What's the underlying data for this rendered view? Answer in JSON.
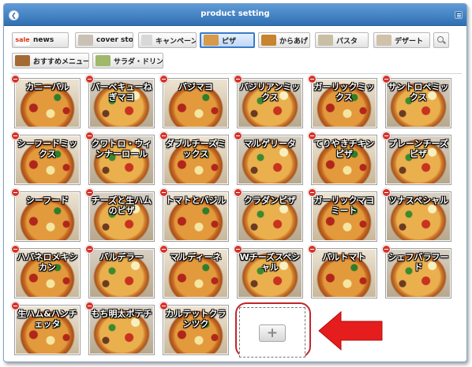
{
  "window": {
    "title": "product setting"
  },
  "tabs": [
    {
      "label": "news",
      "thumb_color": "#ffffff",
      "badge": "sale"
    },
    {
      "label": "cover story",
      "thumb_color": "#c9c1b4"
    },
    {
      "label": "キャンペーン",
      "thumb_color": "#d8d8d8"
    },
    {
      "label": "ピザ",
      "thumb_color": "#d69a4a",
      "active": true
    },
    {
      "label": "からあげ",
      "thumb_color": "#c7832f"
    },
    {
      "label": "パスタ",
      "thumb_color": "#c9bfa4"
    },
    {
      "label": "デザート",
      "thumb_color": "#cfc2a8"
    },
    {
      "label": "",
      "icon": "search-icon"
    },
    {
      "label": "おすすめメニュー",
      "thumb_color": "#a46a32"
    },
    {
      "label": "サラダ・ドリンク",
      "thumb_color": "#9fb86a"
    }
  ],
  "products": [
    "カニーバル",
    "バーベキューねぎマヨ",
    "バジマヨ",
    "バジリアンミックス",
    "ガーリックミックス",
    "サントロペミックス",
    "シーフードミックス",
    "クワトロ・ウィンナーロール",
    "ダブルチーズミックス",
    "マルゲリータ",
    "てりやきチキンピザ",
    "プレーンチーズピザ",
    "シーフード",
    "チーズと生ハムのピザ",
    "トマトとバジル",
    "クラダンピザ",
    "ガーリックマヨミート",
    "ツナスペシャル",
    "ハバネロメキシカン",
    "バルデラー",
    "マルディーネ",
    "Wチーズスペシャル",
    "パルトマト",
    "シェフバラフード",
    "生ハム&ハンチェッタ",
    "もち明太ポテチ",
    "カルテットクランツク"
  ],
  "add_button": {
    "label": "+"
  },
  "colors": {
    "titlebar": "#3a7bc8",
    "delete": "#d6332a",
    "highlight": "#c0262a",
    "arrow": "#e51d1d"
  }
}
